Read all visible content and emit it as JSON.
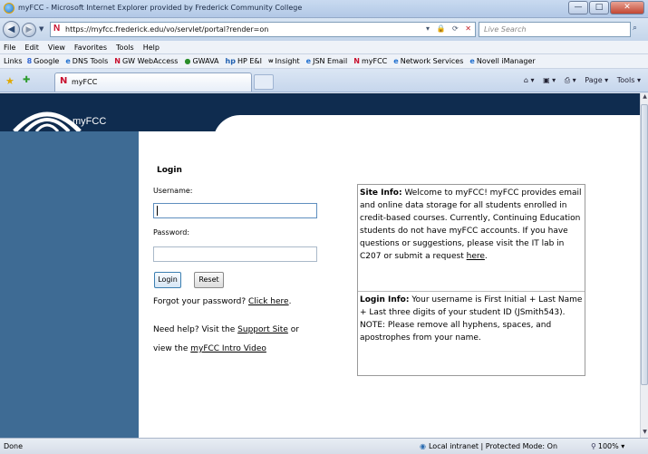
{
  "window": {
    "title": "myFCC - Microsoft Internet Explorer provided by Frederick Community College",
    "minimize": "—",
    "maximize": "□",
    "close": "✕"
  },
  "address": {
    "url": "https://myfcc.frederick.edu/vo/servlet/portal?render=on",
    "search_placeholder": "Live Search"
  },
  "menu": [
    "File",
    "Edit",
    "View",
    "Favorites",
    "Tools",
    "Help"
  ],
  "links_bar": {
    "label": "Links",
    "items": [
      {
        "icon": "8",
        "text": "Google"
      },
      {
        "icon": "e",
        "text": "DNS Tools"
      },
      {
        "icon": "N",
        "text": "GW WebAccess"
      },
      {
        "icon": "●",
        "text": "GWAVA"
      },
      {
        "icon": "hp",
        "text": "HP E&I"
      },
      {
        "icon": "w",
        "text": "Insight"
      },
      {
        "icon": "e",
        "text": "JSN Email"
      },
      {
        "icon": "N",
        "text": "myFCC"
      },
      {
        "icon": "e",
        "text": "Network Services"
      },
      {
        "icon": "e",
        "text": "Novell iManager"
      }
    ]
  },
  "tab": {
    "label": "myFCC",
    "commands": [
      "Page ▾",
      "Tools ▾"
    ]
  },
  "page": {
    "logo_text": "myFCC",
    "login_title": "Login",
    "username_label": "Username:",
    "password_label": "Password:",
    "login_button": "Login",
    "reset_button": "Reset",
    "forgot_text": "Forgot your password?",
    "forgot_link": "Click here",
    "forgot_end": ".",
    "help_text": "Need help? Visit the",
    "support_link": "Support Site",
    "help_or": "or",
    "view_text": "view the",
    "video_link": "myFCC Intro Video",
    "site_info_label": "Site Info:",
    "site_info_text": "Welcome to myFCC! myFCC provides email and online data storage for all students enrolled in credit-based courses. Currently, Continuing Education students do not have myFCC accounts. If you have questions or suggestions, please visit the IT lab in C207 or submit a request",
    "site_info_link": "here",
    "site_info_end": ".",
    "login_info_label": "Login Info:",
    "login_info_text": "Your username is First Initial + Last Name + Last three digits of your student ID (JSmith543). NOTE: Please remove all hyphens, spaces, and apostrophes from your name."
  },
  "status": {
    "left": "Done",
    "zone": "Local intranet | Protected Mode: On",
    "zoom": "100%"
  }
}
